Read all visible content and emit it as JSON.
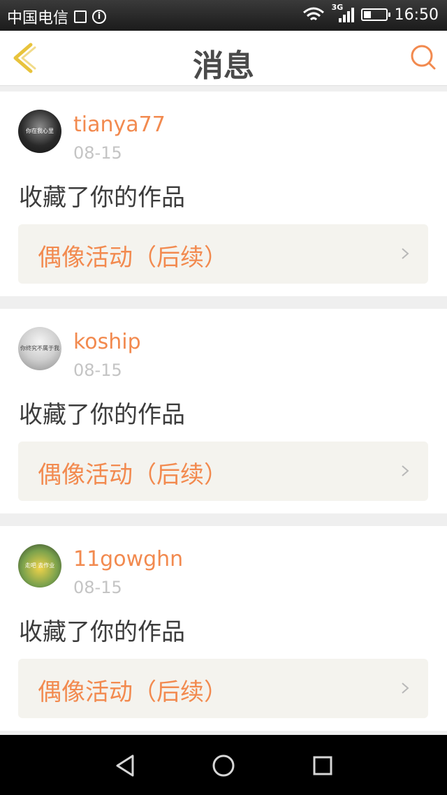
{
  "status_bar": {
    "carrier": "中国电信",
    "network": "3G",
    "time": "16:50"
  },
  "header": {
    "title": "消息"
  },
  "messages": [
    {
      "username": "tianya77",
      "date": "08-15",
      "action": "收藏了你的作品",
      "work_title": "偶像活动（后续）",
      "avatar_text": "你在我心里"
    },
    {
      "username": "koship",
      "date": "08-15",
      "action": "收藏了你的作品",
      "work_title": "偶像活动（后续）",
      "avatar_text": "你终究不属于我"
    },
    {
      "username": "11gowghn",
      "date": "08-15",
      "action": "收藏了你的作品",
      "work_title": "偶像活动（后续）",
      "avatar_text": "走吧 去作业"
    }
  ],
  "colors": {
    "accent": "#f28a4f",
    "title_text": "#4a4a4a",
    "secondary_text": "#c4c4c4",
    "work_box_bg": "#f4f3ee",
    "back_icon": "#e8c33c"
  },
  "icons": {
    "back": "chevron-left-icon",
    "search": "search-icon",
    "nav_back": "triangle-back-icon",
    "nav_home": "circle-home-icon",
    "nav_recent": "square-recent-icon"
  }
}
